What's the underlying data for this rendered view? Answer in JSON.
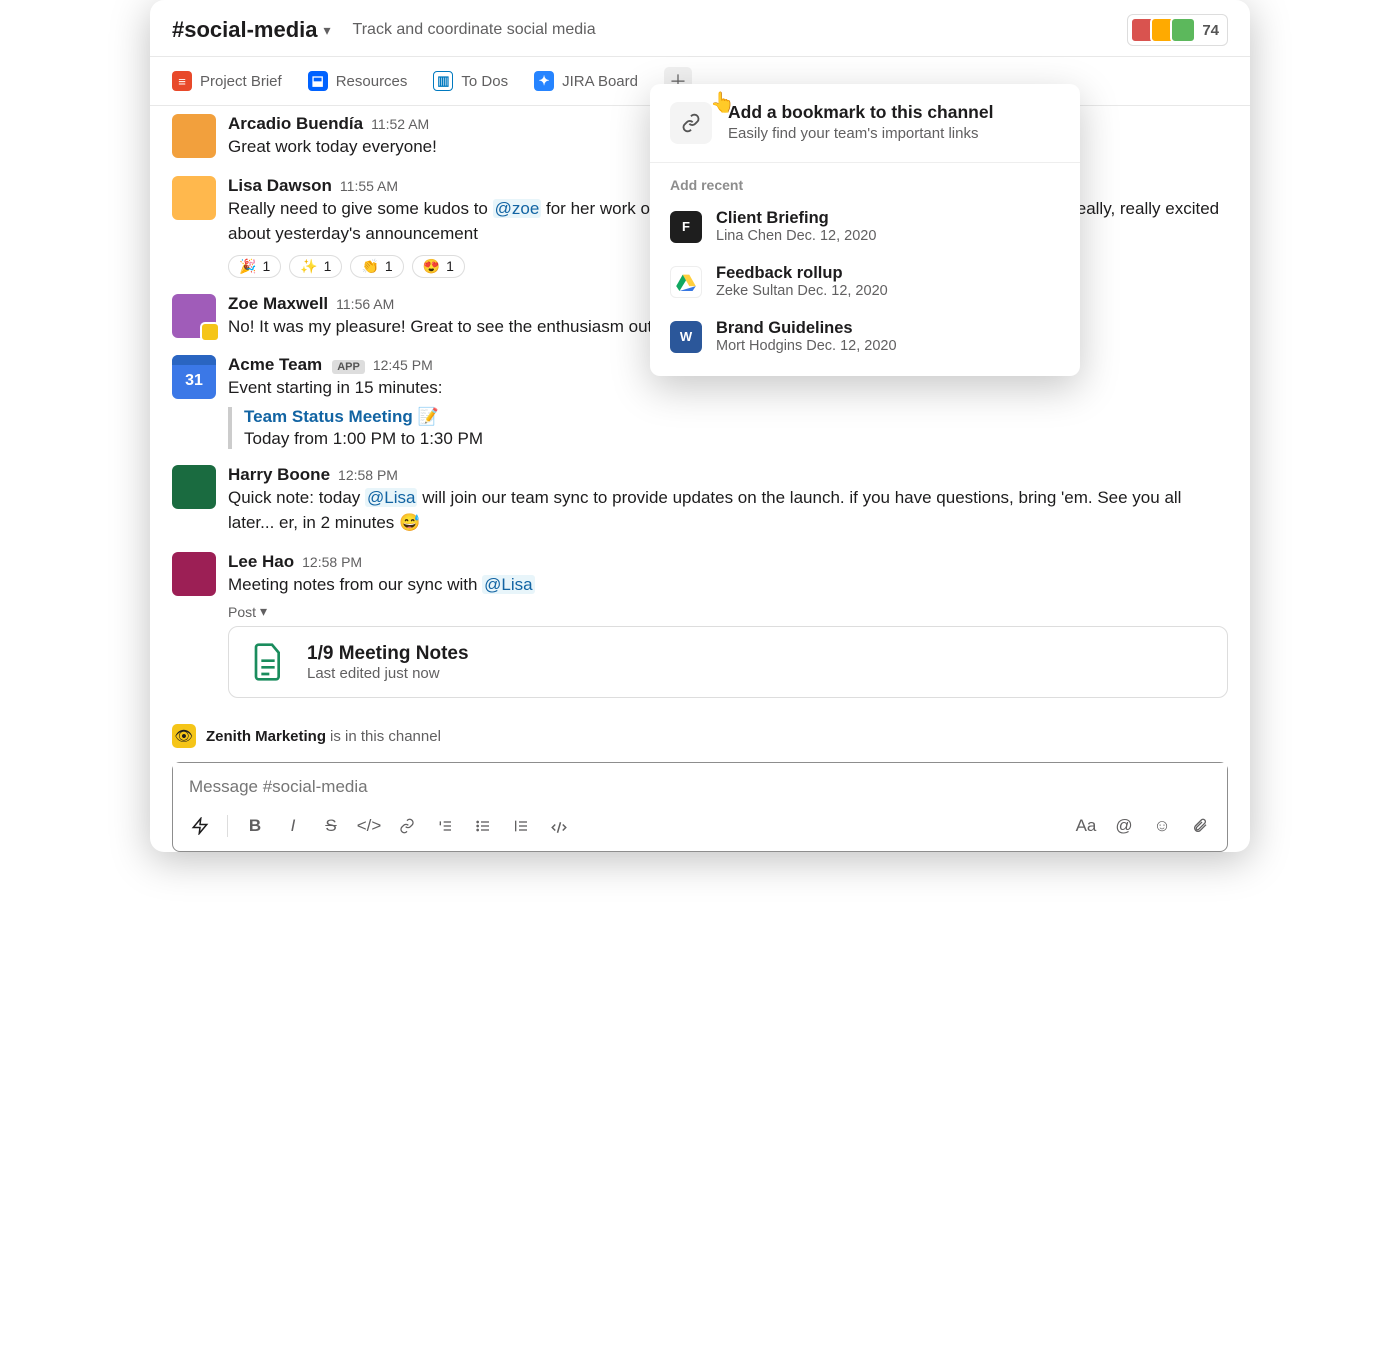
{
  "header": {
    "channel_name": "#social-media",
    "description": "Track and coordinate social media",
    "member_count": "74"
  },
  "bookmarks": [
    {
      "label": "Project Brief"
    },
    {
      "label": "Resources"
    },
    {
      "label": "To Dos"
    },
    {
      "label": "JIRA Board"
    }
  ],
  "popover": {
    "title": "Add a bookmark to this channel",
    "subtitle": "Easily find your team's important links",
    "section_label": "Add recent",
    "items": [
      {
        "title": "Client Briefing",
        "meta": "Lina Chen Dec. 12, 2020"
      },
      {
        "title": "Feedback rollup",
        "meta": "Zeke Sultan Dec. 12, 2020"
      },
      {
        "title": "Brand Guidelines",
        "meta": "Mort Hodgins Dec. 12, 2020"
      }
    ]
  },
  "messages": {
    "m0": {
      "author": "Arcadio Buendía",
      "ts": "11:52 AM",
      "body": "Great work today everyone!"
    },
    "m1": {
      "author": "Lisa Dawson",
      "ts": "11:55 AM",
      "body_a": "Really need to give some kudos to ",
      "mention": "@zoe",
      "body_b": " for her work on the latest launch, we crushed it yesterday. People are really, really excited about yesterday's announcement",
      "reactions": [
        {
          "emoji": "🎉",
          "count": "1"
        },
        {
          "emoji": "✨",
          "count": "1"
        },
        {
          "emoji": "👏",
          "count": "1"
        },
        {
          "emoji": "😍",
          "count": "1"
        }
      ]
    },
    "m2": {
      "author": "Zoe Maxwell",
      "ts": "11:56 AM",
      "body": "No! It was my pleasure! Great to see the enthusiasm out there."
    },
    "m3": {
      "author": "Acme Team",
      "app": "APP",
      "ts": "12:45 PM",
      "body": "Event starting in 15 minutes:",
      "event": {
        "title": "Team Status Meeting",
        "emoji": "📝",
        "time": "Today from 1:00 PM to 1:30 PM"
      },
      "cal": "31"
    },
    "m4": {
      "author": "Harry Boone",
      "ts": "12:58 PM",
      "body_a": "Quick note: today ",
      "mention": "@Lisa",
      "body_b": " will join our team sync to provide updates on the launch. if you have questions, bring 'em. See you all later... er, in 2 minutes 😅"
    },
    "m5": {
      "author": "Lee Hao",
      "ts": "12:58 PM",
      "body_a": "Meeting notes from our sync with ",
      "mention": "@Lisa",
      "post": {
        "label": "Post",
        "title": "1/9 Meeting Notes",
        "sub": "Last edited just now"
      }
    }
  },
  "notice": {
    "name": "Zenith Marketing",
    "tail": "is in this channel"
  },
  "composer": {
    "placeholder": "Message #social-media"
  }
}
